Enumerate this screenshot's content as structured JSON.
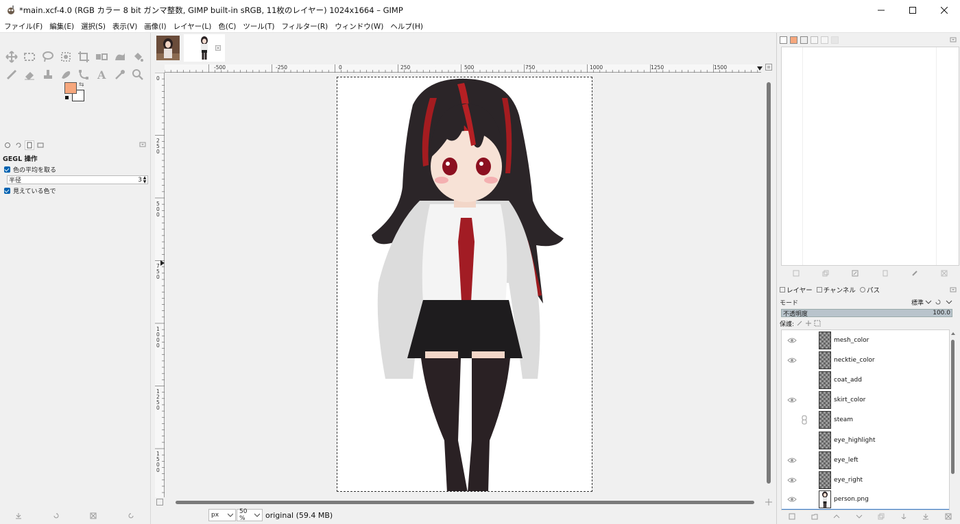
{
  "window": {
    "title": "*main.xcf-4.0 (RGB カラー 8 bit ガンマ整数, GIMP built-in sRGB, 11枚のレイヤー) 1024x1664 – GIMP"
  },
  "menu": [
    "ファイル(F)",
    "編集(E)",
    "選択(S)",
    "表示(V)",
    "画像(I)",
    "レイヤー(L)",
    "色(C)",
    "ツール(T)",
    "フィルター(R)",
    "ウィンドウ(W)",
    "ヘルプ(H)"
  ],
  "colors": {
    "foreground": "#f6a77d",
    "background": "#ffffff"
  },
  "tool_options": {
    "title": "GEGL 操作",
    "average_checkbox": "色の平均を取る",
    "radius_label": "半径",
    "radius_value": "3",
    "visible_checkbox": "見えている色で"
  },
  "rulers": {
    "h_ticks": [
      "-500",
      "-250",
      "0",
      "250",
      "500",
      "750",
      "1000",
      "1250",
      "1500"
    ],
    "v_ticks": [
      "0",
      "250",
      "500",
      "750",
      "1000",
      "1250",
      "1500"
    ]
  },
  "status": {
    "unit": "px",
    "zoom": "50 %",
    "text": "original (59.4 MB)"
  },
  "layers_panel": {
    "tabs": [
      "レイヤー",
      "チャンネル",
      "パス"
    ],
    "mode_label": "モード",
    "mode_value": "標準",
    "opacity_label": "不透明度",
    "opacity_value": "100.0",
    "lock_label": "保護:",
    "layers": [
      {
        "name": "mesh_color",
        "visible": true,
        "linked": false
      },
      {
        "name": "necktie_color",
        "visible": true,
        "linked": false
      },
      {
        "name": "coat_add",
        "visible": false,
        "linked": false
      },
      {
        "name": "skirt_color",
        "visible": true,
        "linked": false
      },
      {
        "name": "steam",
        "visible": false,
        "linked": true
      },
      {
        "name": "eye_highlight",
        "visible": false,
        "linked": false
      },
      {
        "name": "eye_left",
        "visible": true,
        "linked": false
      },
      {
        "name": "eye_right",
        "visible": true,
        "linked": false
      },
      {
        "name": "person.png",
        "visible": true,
        "linked": false,
        "selected": true
      }
    ]
  }
}
